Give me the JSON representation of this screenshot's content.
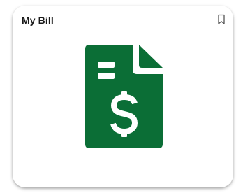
{
  "card": {
    "title": "My Bill",
    "bookmark_icon": "bookmark-outline-icon",
    "main_icon": "bill-document-dollar-icon"
  },
  "colors": {
    "icon_green": "#0b6e36",
    "title_text": "#1a1a1a",
    "card_background": "#ffffff"
  }
}
